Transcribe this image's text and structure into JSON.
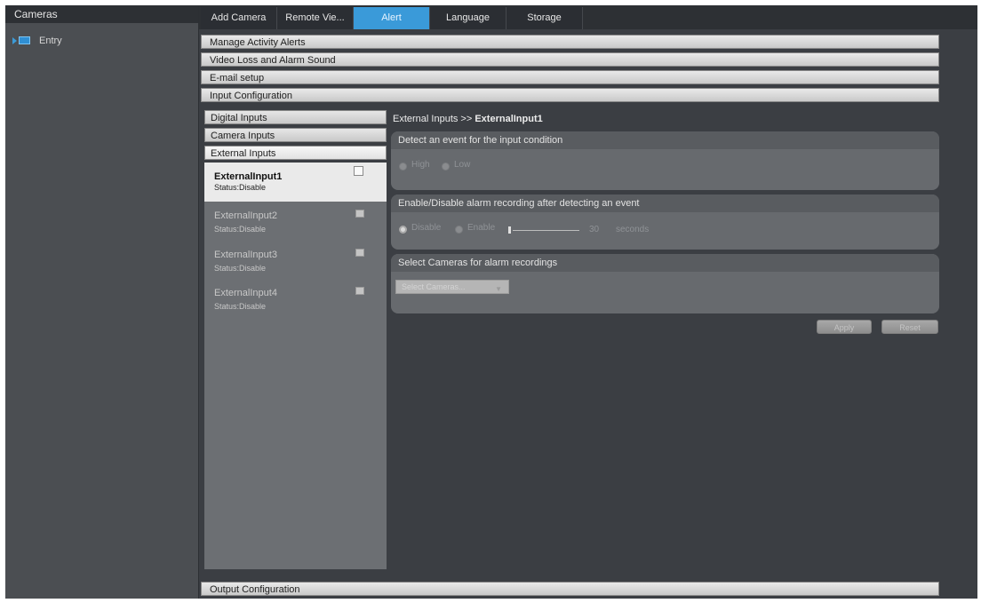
{
  "left": {
    "title": "Cameras",
    "tree_item": "Entry"
  },
  "tabs": [
    "Add Camera",
    "Remote Vie...",
    "Alert",
    "Language",
    "Storage"
  ],
  "sections": {
    "manage": "Manage Activity Alerts",
    "video_loss": "Video Loss and Alarm Sound",
    "email": "E-mail setup",
    "input_config": "Input Configuration",
    "output_config": "Output Configuration"
  },
  "subnav": [
    "Digital Inputs",
    "Camera Inputs",
    "External Inputs"
  ],
  "inputs": [
    {
      "name": "ExternalInput1",
      "status": "Status:Disable",
      "selected": true
    },
    {
      "name": "ExternalInput2",
      "status": "Status:Disable"
    },
    {
      "name": "ExternalInput3",
      "status": "Status:Disable"
    },
    {
      "name": "ExternalInput4",
      "status": "Status:Disable"
    }
  ],
  "breadcrumb": {
    "prefix": "External Inputs >> ",
    "current": "ExternalInput1"
  },
  "detect": {
    "title": "Detect an event for the input condition",
    "high": "High",
    "low": "Low"
  },
  "alarm": {
    "title": "Enable/Disable alarm recording after detecting an event",
    "disable": "Disable",
    "enable": "Enable",
    "value": "30",
    "unit": "seconds"
  },
  "cameras": {
    "title": "Select Cameras for alarm recordings",
    "placeholder": "Select Cameras..."
  },
  "buttons": {
    "apply": "Apply",
    "reset": "Reset"
  },
  "colors": {
    "accent": "#3a9ad9"
  }
}
